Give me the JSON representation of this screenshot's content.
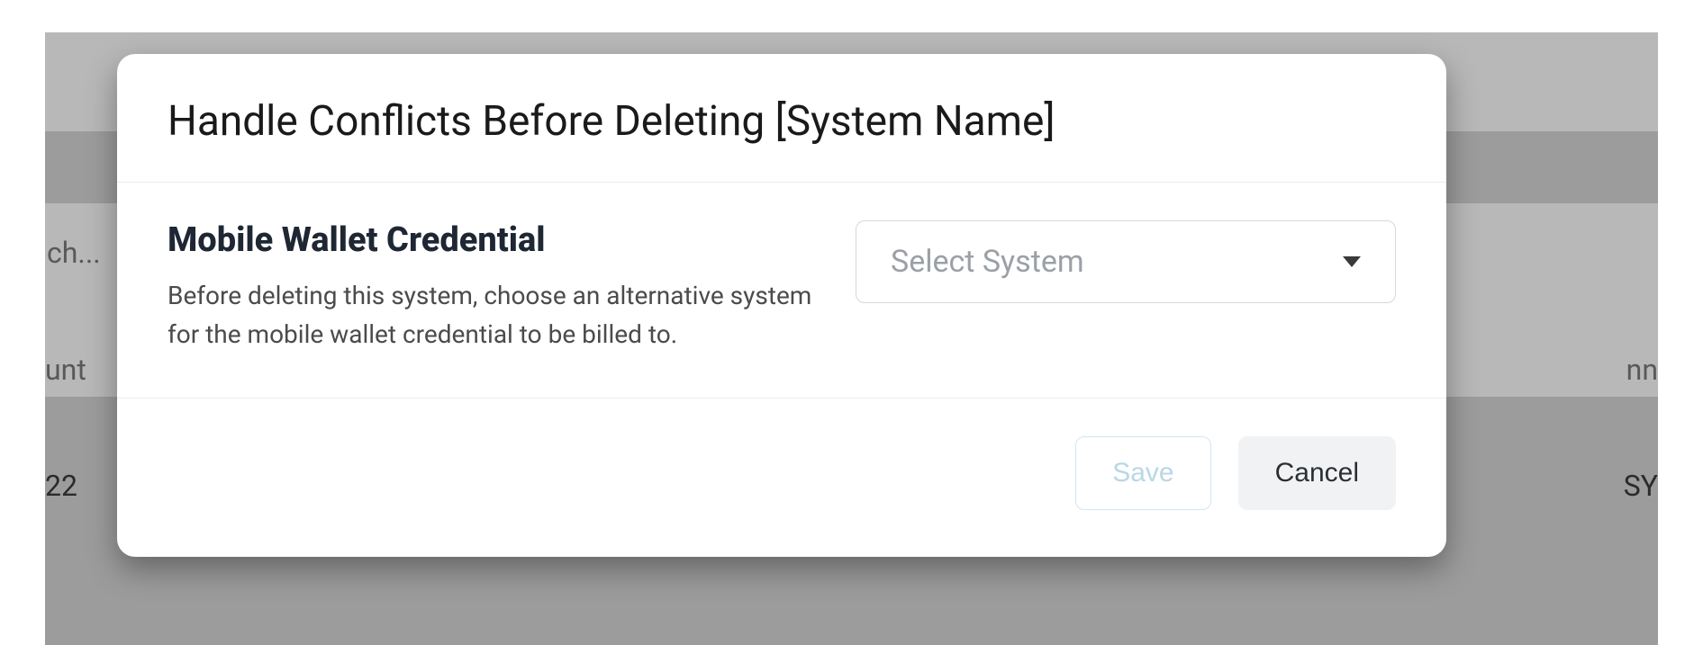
{
  "background": {
    "fragments": {
      "left1": "ch...",
      "left2": "unt",
      "left3": "22",
      "right1": "nn",
      "right2": "SY"
    }
  },
  "modal": {
    "title": "Handle Conflicts Before Deleting [System Name]",
    "section_heading": "Mobile Wallet Credential",
    "section_desc": "Before deleting this system, choose an alternative system for the mobile wallet credential to be billed to.",
    "select_placeholder": "Select System",
    "buttons": {
      "save": "Save",
      "cancel": "Cancel"
    }
  }
}
